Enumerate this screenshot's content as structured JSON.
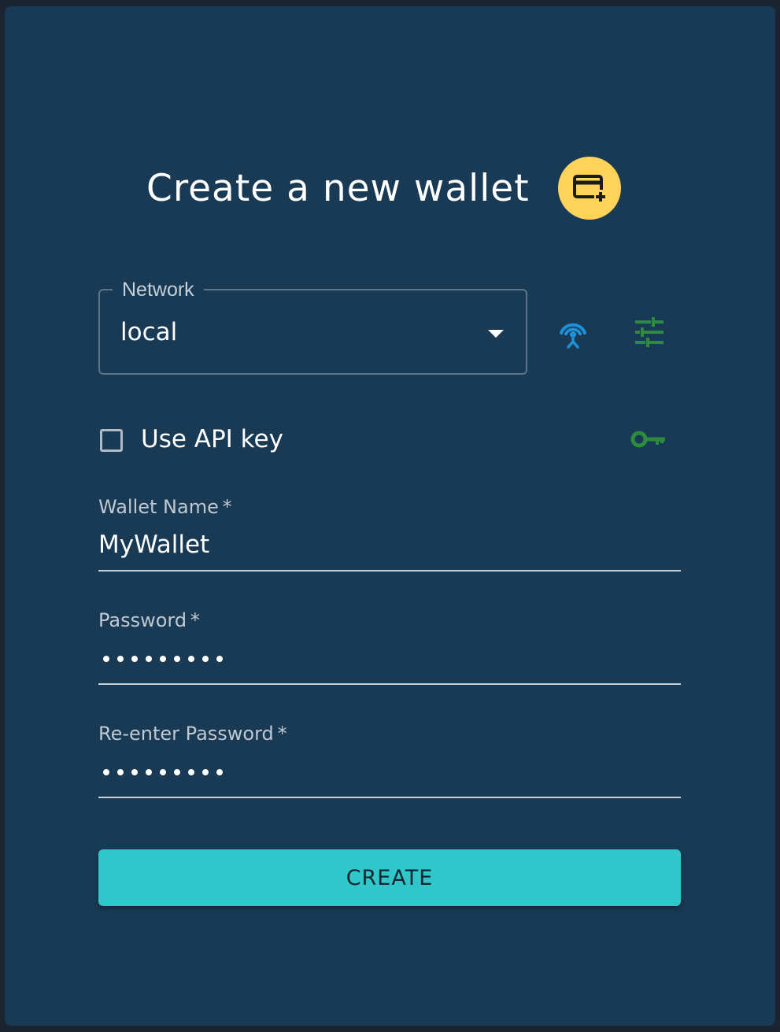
{
  "header": {
    "title": "Create a new wallet",
    "badge_icon": "wallet-add-icon",
    "badge_color": "#ffd25a"
  },
  "network": {
    "label": "Network",
    "value": "local",
    "connection_icon": "broadcast-antenna-icon",
    "connection_icon_color": "#1e90d8",
    "settings_icon": "tune-sliders-icon",
    "settings_icon_color": "#2e8b3d"
  },
  "api_key": {
    "label": "Use API key",
    "checked": false,
    "icon": "key-icon",
    "icon_color": "#2e8b3d"
  },
  "wallet_name": {
    "label": "Wallet Name",
    "required_mark": "*",
    "value": "MyWallet"
  },
  "password": {
    "label": "Password",
    "required_mark": "*",
    "masked_length": 9
  },
  "confirm_password": {
    "label": "Re-enter Password",
    "required_mark": "*",
    "masked_length": 9
  },
  "actions": {
    "create_label": "CREATE",
    "create_color": "#31c6c9"
  },
  "theme": {
    "background": "#1b2430",
    "card": "#183a54"
  }
}
